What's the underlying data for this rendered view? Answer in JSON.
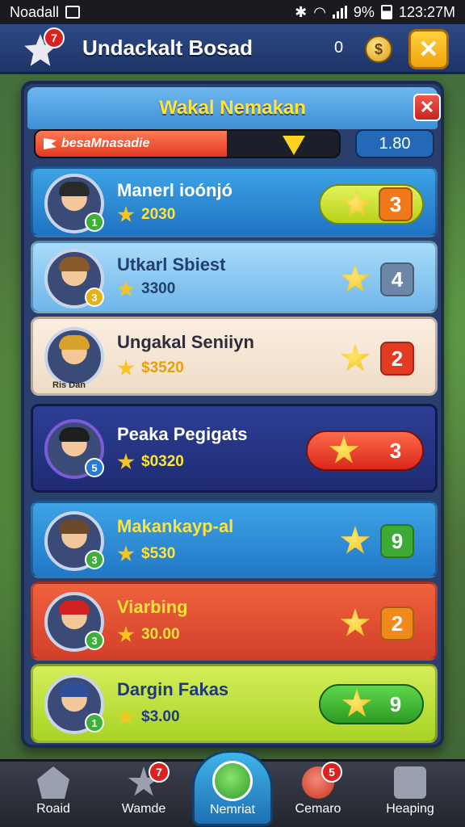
{
  "status_bar": {
    "carrier": "Noadall",
    "battery": "9%",
    "time": "123:27M"
  },
  "header": {
    "title": "Undackalt Bosad",
    "notification_count": "7",
    "coin_count": "0"
  },
  "panel": {
    "title": "Wakal Nemakan",
    "progress": {
      "label": "besaMnasadie",
      "fraction": 0.63
    },
    "score": "1.80"
  },
  "rows": [
    {
      "name": "Manerl ioónjó",
      "cost": "2030",
      "action_value": "3",
      "level": "1"
    },
    {
      "name": "Utkarl Sbiest",
      "cost": "3300",
      "action_value": "4",
      "level": "3"
    },
    {
      "name": "Ungakal Seniiyn",
      "cost": "$3520",
      "action_value": "2",
      "level": "",
      "avatar_caption": "Ris Dan"
    },
    {
      "name": "Peaka Pegigats",
      "cost": "$0320",
      "action_value": "3",
      "level": "5"
    },
    {
      "name": "Makankayp-al",
      "cost": "$530",
      "action_value": "9",
      "level": "3"
    },
    {
      "name": "Viarbing",
      "cost": "30.00",
      "action_value": "2",
      "level": "3"
    },
    {
      "name": "Dargin Fakas",
      "cost": "$3.00",
      "action_value": "9",
      "level": "1"
    }
  ],
  "bottom_nav": {
    "items": [
      {
        "label": "Roaid"
      },
      {
        "label": "Wamde",
        "badge": "7"
      },
      {
        "label": "Nemriat"
      },
      {
        "label": "Cemaro",
        "badge": "5"
      },
      {
        "label": "Heaping"
      }
    ]
  },
  "colors": {
    "gold": "#f7c51e",
    "panel_bg": "#2a3f6e",
    "header_blue": "#2d4a86"
  }
}
